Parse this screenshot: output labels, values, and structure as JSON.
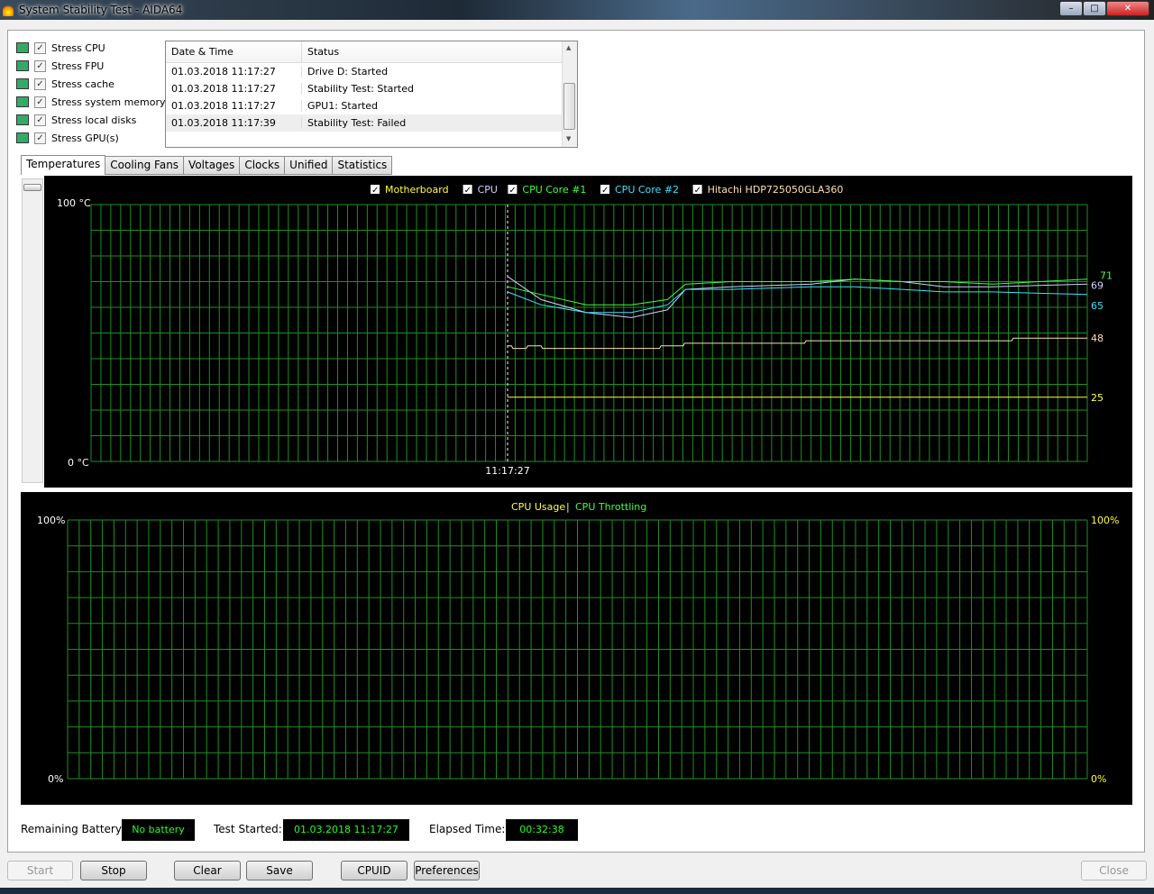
{
  "window": {
    "title": "System Stability Test - AIDA64"
  },
  "options": [
    {
      "label": "Stress CPU",
      "checked": true,
      "icon": "cpu-chip-icon"
    },
    {
      "label": "Stress FPU",
      "checked": true,
      "icon": "fpu-icon"
    },
    {
      "label": "Stress cache",
      "checked": true,
      "icon": "cache-icon"
    },
    {
      "label": "Stress system memory",
      "checked": true,
      "icon": "memory-icon"
    },
    {
      "label": "Stress local disks",
      "checked": true,
      "icon": "disk-icon"
    },
    {
      "label": "Stress GPU(s)",
      "checked": true,
      "icon": "gpu-icon"
    }
  ],
  "log": {
    "columns": [
      "Date & Time",
      "Status"
    ],
    "rows": [
      [
        "01.03.2018 11:17:27",
        "Drive D: Started"
      ],
      [
        "01.03.2018 11:17:27",
        "Stability Test: Started"
      ],
      [
        "01.03.2018 11:17:27",
        "GPU1: Started"
      ],
      [
        "01.03.2018 11:17:39",
        "Stability Test: Failed"
      ]
    ]
  },
  "tabs": [
    "Temperatures",
    "Cooling Fans",
    "Voltages",
    "Clocks",
    "Unified",
    "Statistics"
  ],
  "active_tab": "Temperatures",
  "chart_data": [
    {
      "type": "line",
      "ylim": [
        0,
        100
      ],
      "ytick_labels": [
        "100 °C",
        "0 °C"
      ],
      "xtick_labels": [
        "11:17:27"
      ],
      "grid": true,
      "legend_placement": "top-center",
      "marker_time": "11:17:27",
      "end_time": "11:50:05",
      "series": [
        {
          "name": "Motherboard",
          "color": "#ffff40",
          "checked": true,
          "end_label": "25",
          "points": [
            [
              "11:17:27",
              25
            ],
            [
              "11:50:05",
              25
            ]
          ]
        },
        {
          "name": "CPU",
          "color": "#d0d0ff",
          "checked": true,
          "end_label": "69",
          "points": [
            [
              "11:17:27",
              72
            ],
            [
              "11:19:20",
              63
            ],
            [
              "11:21:52",
              58
            ],
            [
              "11:24:25",
              56
            ],
            [
              "11:26:27",
              59
            ],
            [
              "11:27:28",
              67
            ],
            [
              "11:30:00",
              68
            ],
            [
              "11:34:34",
              69
            ],
            [
              "11:37:00",
              71
            ],
            [
              "11:39:39",
              70
            ],
            [
              "11:42:00",
              68
            ],
            [
              "11:44:44",
              68
            ],
            [
              "11:50:05",
              69
            ]
          ]
        },
        {
          "name": "CPU Core #1",
          "color": "#40ff40",
          "checked": true,
          "end_label": "71",
          "points": [
            [
              "11:17:27",
              68
            ],
            [
              "11:19:20",
              65
            ],
            [
              "11:21:52",
              61
            ],
            [
              "11:24:25",
              61
            ],
            [
              "11:26:27",
              63
            ],
            [
              "11:27:28",
              69
            ],
            [
              "11:30:00",
              70
            ],
            [
              "11:34:34",
              70
            ],
            [
              "11:37:00",
              71
            ],
            [
              "11:39:39",
              70
            ],
            [
              "11:42:00",
              70
            ],
            [
              "11:44:44",
              69
            ],
            [
              "11:50:05",
              71
            ]
          ]
        },
        {
          "name": "CPU Core #2",
          "color": "#40e0ff",
          "checked": true,
          "end_label": "65",
          "points": [
            [
              "11:17:27",
              66
            ],
            [
              "11:19:20",
              61
            ],
            [
              "11:21:52",
              58
            ],
            [
              "11:24:25",
              58
            ],
            [
              "11:26:27",
              61
            ],
            [
              "11:27:28",
              67
            ],
            [
              "11:30:00",
              67
            ],
            [
              "11:34:34",
              68
            ],
            [
              "11:37:00",
              68
            ],
            [
              "11:39:39",
              67
            ],
            [
              "11:42:00",
              66
            ],
            [
              "11:44:44",
              66
            ],
            [
              "11:50:05",
              65
            ]
          ]
        },
        {
          "name": "Hitachi HDP725050GLA360",
          "color": "#ffe0b0",
          "checked": true,
          "end_label": "48",
          "points": [
            [
              "11:17:27",
              45
            ],
            [
              "11:17:40",
              45
            ],
            [
              "11:17:45",
              44
            ],
            [
              "11:18:30",
              44
            ],
            [
              "11:18:35",
              45
            ],
            [
              "11:19:20",
              45
            ],
            [
              "11:19:25",
              44
            ],
            [
              "11:26:00",
              44
            ],
            [
              "11:26:05",
              45
            ],
            [
              "11:27:20",
              45
            ],
            [
              "11:27:25",
              46
            ],
            [
              "11:34:10",
              46
            ],
            [
              "11:34:15",
              47
            ],
            [
              "11:45:50",
              47
            ],
            [
              "11:45:55",
              48
            ],
            [
              "11:50:05",
              48
            ]
          ]
        }
      ]
    },
    {
      "type": "line",
      "ylim": [
        0,
        100
      ],
      "ytick_labels_left": [
        "100%",
        "0%"
      ],
      "ytick_labels_right": [
        "100%",
        "0%"
      ],
      "grid": true,
      "legend_placement": "top-center",
      "series": [
        {
          "name": "CPU Usage",
          "color": "#ffff40",
          "points": []
        },
        {
          "name": "CPU Throttling",
          "color": "#40ff40",
          "points": []
        }
      ],
      "legend_separator": "|"
    }
  ],
  "status": {
    "battery_label": "Remaining Battery:",
    "battery_value": "No battery",
    "started_label": "Test Started:",
    "started_value": "01.03.2018 11:17:27",
    "elapsed_label": "Elapsed Time:",
    "elapsed_value": "00:32:38"
  },
  "buttons": {
    "start": "Start",
    "stop": "Stop",
    "clear": "Clear",
    "save": "Save",
    "cpuid": "CPUID",
    "preferences": "Preferences",
    "close": "Close"
  },
  "colors": {
    "grid": "#1f8f1f",
    "chart_bg": "#000000",
    "status_text": "#22ff22"
  }
}
